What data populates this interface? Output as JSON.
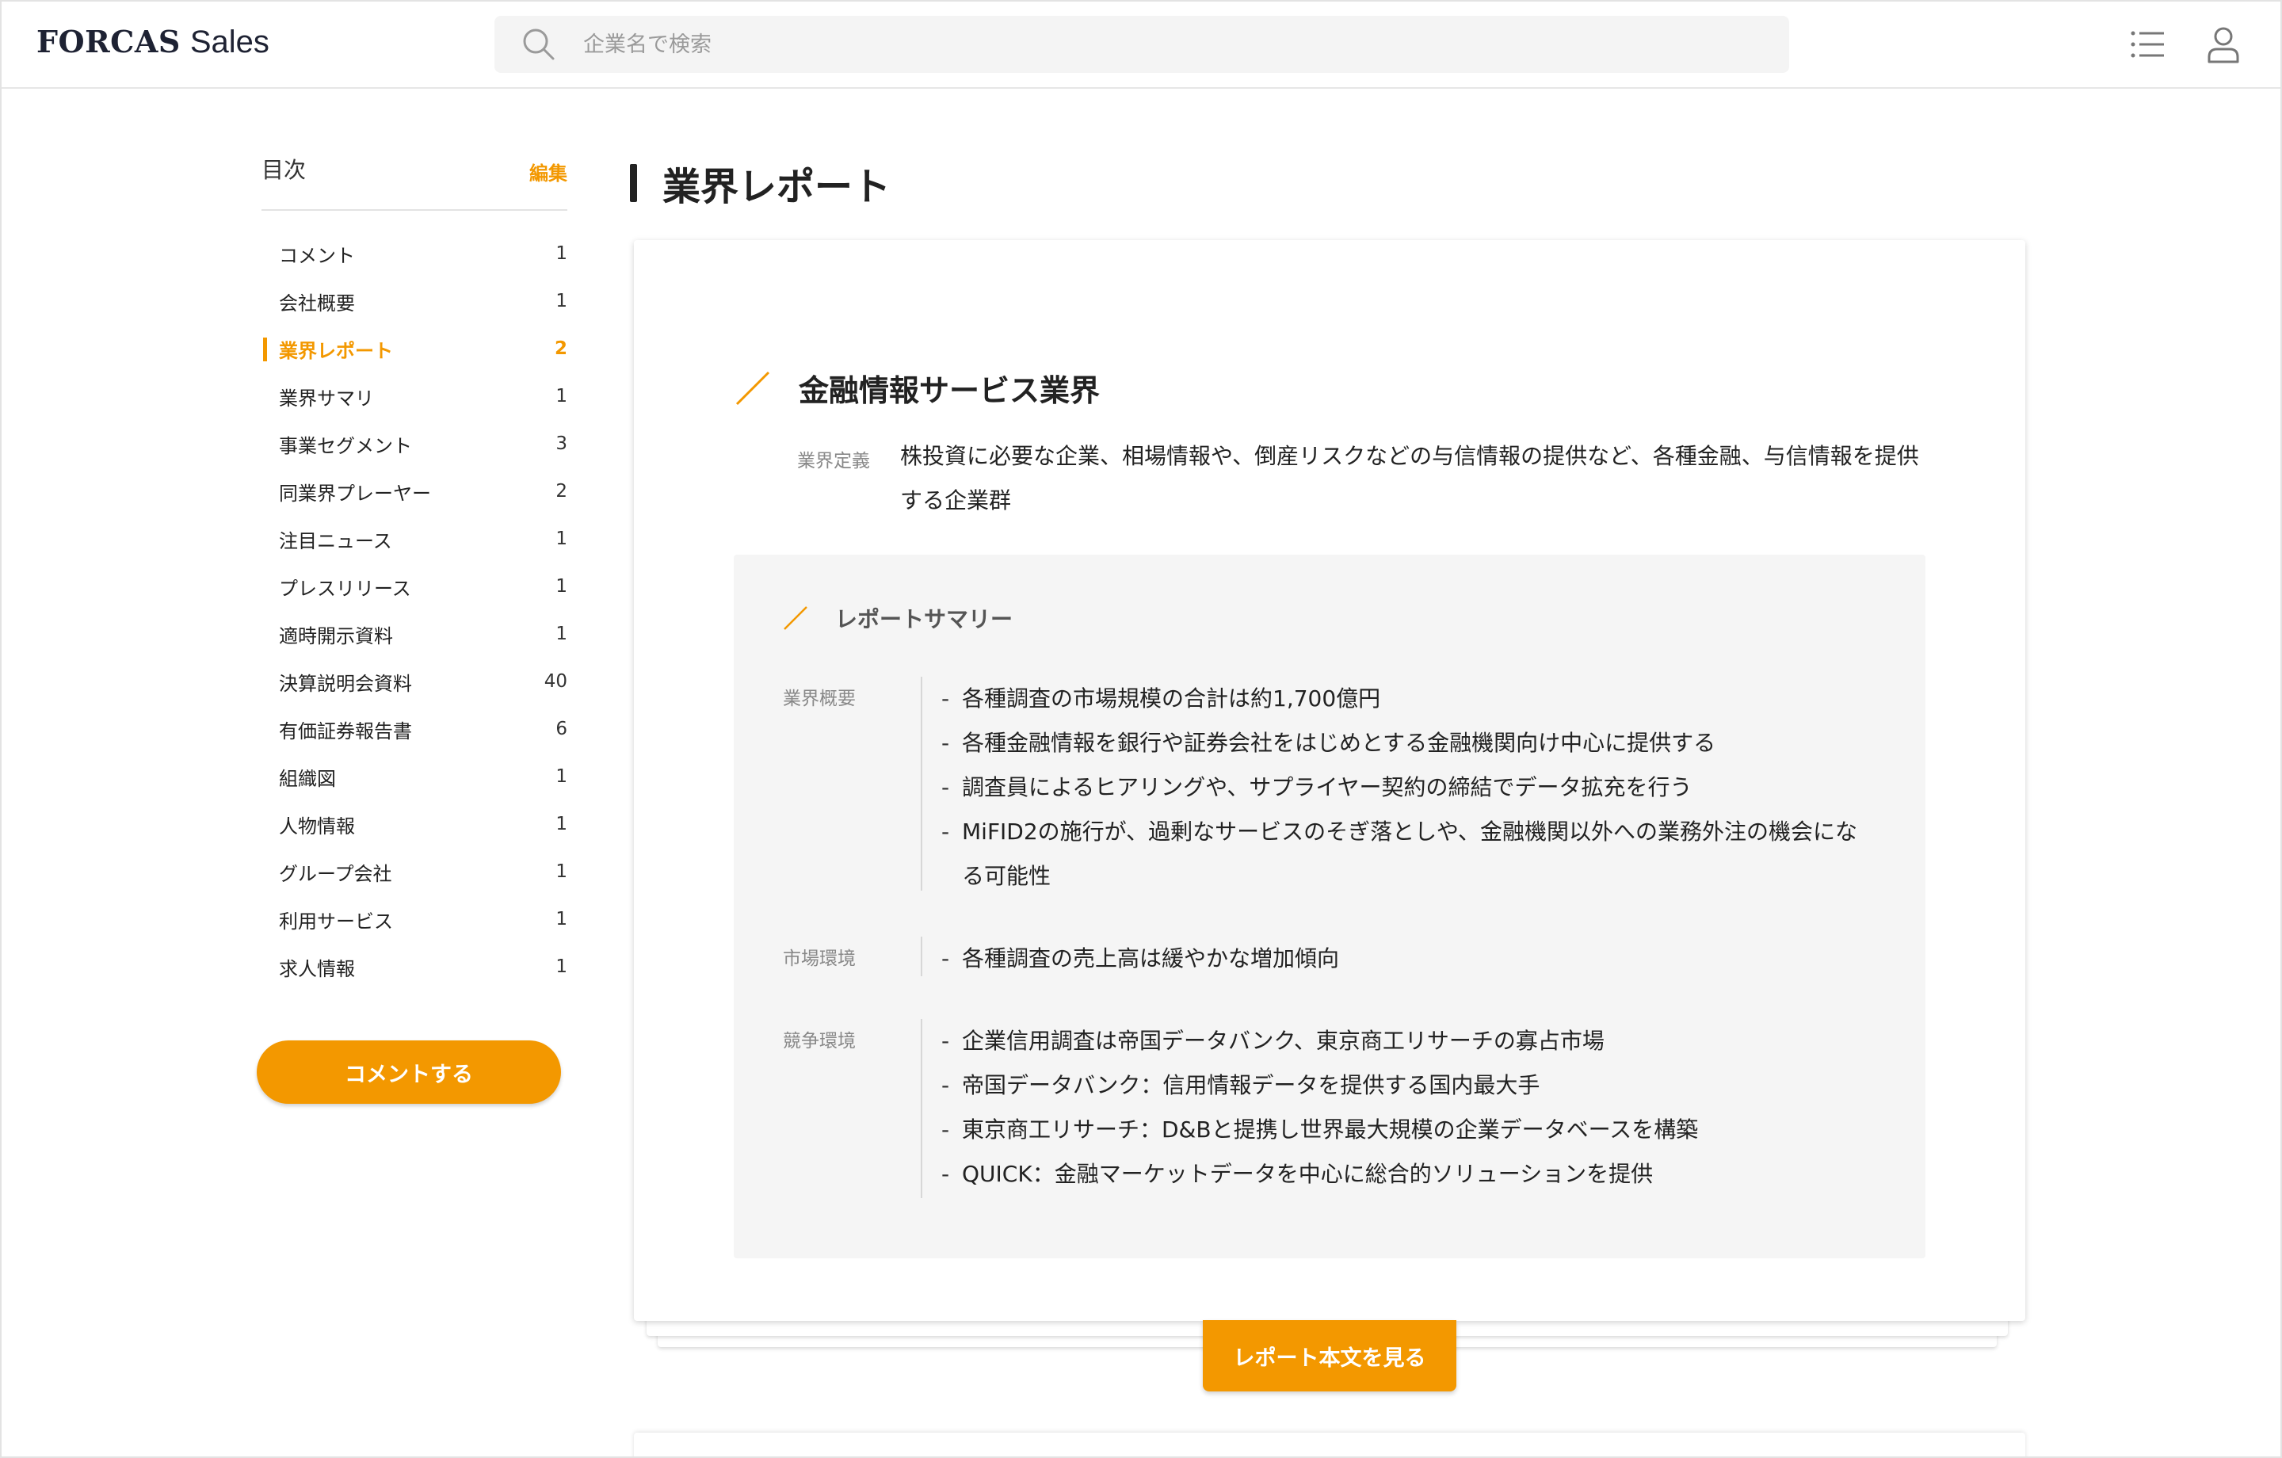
{
  "header": {
    "brand_strong": "FORCAS",
    "brand_light": "Sales",
    "search_placeholder": "企業名で検索",
    "icons": [
      "search-icon",
      "list-icon",
      "user-icon"
    ]
  },
  "sidebar": {
    "title": "目次",
    "edit_label": "編集",
    "items": [
      {
        "label": "コメント",
        "count": "1"
      },
      {
        "label": "会社概要",
        "count": "1"
      },
      {
        "label": "業界レポート",
        "count": "2",
        "active": true
      },
      {
        "label": "業界サマリ",
        "count": "1"
      },
      {
        "label": "事業セグメント",
        "count": "3"
      },
      {
        "label": "同業界プレーヤー",
        "count": "2"
      },
      {
        "label": "注目ニュース",
        "count": "1"
      },
      {
        "label": "プレスリリース",
        "count": "1"
      },
      {
        "label": "適時開示資料",
        "count": "1"
      },
      {
        "label": "決算説明会資料",
        "count": "40"
      },
      {
        "label": "有価証券報告書",
        "count": "6"
      },
      {
        "label": "組織図",
        "count": "1"
      },
      {
        "label": "人物情報",
        "count": "1"
      },
      {
        "label": "グループ会社",
        "count": "1"
      },
      {
        "label": "利用サービス",
        "count": "1"
      },
      {
        "label": "求人情報",
        "count": "1"
      }
    ],
    "comment_button": "コメントする"
  },
  "main": {
    "page_title": "業界レポート",
    "industry": {
      "title": "金融情報サービス業界",
      "definition_label": "業界定義",
      "definition_text": "株投資に必要な企業、相場情報や、倒産リスクなどの与信情報の提供など、各種金融、与信情報を提供する企業群"
    },
    "summary": {
      "title": "レポートサマリー",
      "groups": [
        {
          "label": "業界概要",
          "items": [
            "各種調査の市場規模の合計は約1,700億円",
            "各種金融情報を銀行や証券会社をはじめとする金融機関向け中心に提供する",
            "調査員によるヒアリングや、サプライヤー契約の締結でデータ拡充を行う",
            "MiFID2の施行が、過剰なサービスのそぎ落としや、金融機関以外への業務外注の機会になる可能性"
          ]
        },
        {
          "label": "市場環境",
          "items": [
            "各種調査の売上高は緩やかな増加傾向"
          ]
        },
        {
          "label": "競争環境",
          "items": [
            "企業信用調査は帝国データバンク、東京商工リサーチの寡占市場",
            "帝国データバンク：信用情報データを提供する国内最大手",
            "東京商工リサーチ：D&Bと提携し世界最大規模の企業データベースを構築",
            "QUICK：金融マーケットデータを中心に総合的ソリューションを提供"
          ]
        }
      ]
    },
    "report_button": "レポート本文を見る"
  },
  "colors": {
    "accent": "#f39800",
    "text": "#222222",
    "muted": "#888888",
    "panel": "#f5f5f5"
  }
}
